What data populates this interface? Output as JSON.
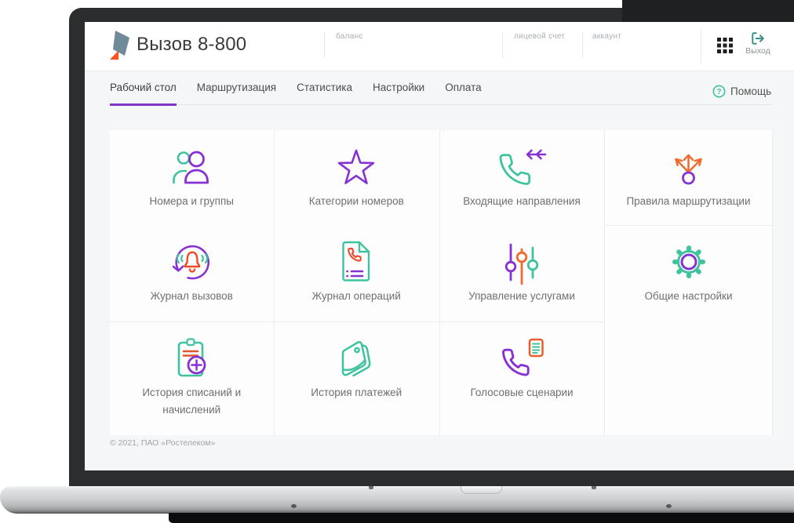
{
  "header": {
    "brand": "Вызов 8-800",
    "fields": [
      {
        "label": "баланс"
      },
      {
        "label": "лицевой счет"
      },
      {
        "label": "аккаунт"
      }
    ],
    "logout_label": "Выход"
  },
  "nav": {
    "tabs": [
      {
        "label": "Рабочий стол",
        "active": true
      },
      {
        "label": "Маршрутизация",
        "active": false
      },
      {
        "label": "Статистика",
        "active": false
      },
      {
        "label": "Настройки",
        "active": false
      },
      {
        "label": "Оплата",
        "active": false
      }
    ],
    "help_label": "Помощь"
  },
  "tiles": [
    {
      "label": "Номера и группы",
      "icon": "users-icon"
    },
    {
      "label": "Категории номеров",
      "icon": "star-icon"
    },
    {
      "label": "Входящие направления",
      "icon": "incoming-call-icon"
    },
    {
      "label": "Правила маршрутизации",
      "icon": "routing-arrows-icon"
    },
    {
      "label": "Журнал вызовов",
      "icon": "call-log-bell-icon"
    },
    {
      "label": "Журнал операций",
      "icon": "operations-document-icon"
    },
    {
      "label": "Управление услугами",
      "icon": "sliders-icon"
    },
    {
      "label": "Общие настройки",
      "icon": "gear-icon"
    },
    {
      "label": "История списаний и начислений",
      "icon": "clipboard-plus-icon"
    },
    {
      "label": "История платежей",
      "icon": "wallet-icon"
    },
    {
      "label": "Голосовые сценарии",
      "icon": "voice-script-icon"
    }
  ],
  "footer": {
    "copyright": "© 2021, ПАО «Ростелеком»"
  },
  "colors": {
    "accent_purple": "#8731d3",
    "accent_teal": "#3ec39e",
    "accent_orange": "#ee6a2e",
    "accent_red_orange": "#ee4526",
    "tab_underline": "#7d35c8",
    "logo_slate": "#6f8b99",
    "logo_orange": "#ff4f1f",
    "help_green": "#3cc29e",
    "exit_teal": "#3b8f89"
  }
}
